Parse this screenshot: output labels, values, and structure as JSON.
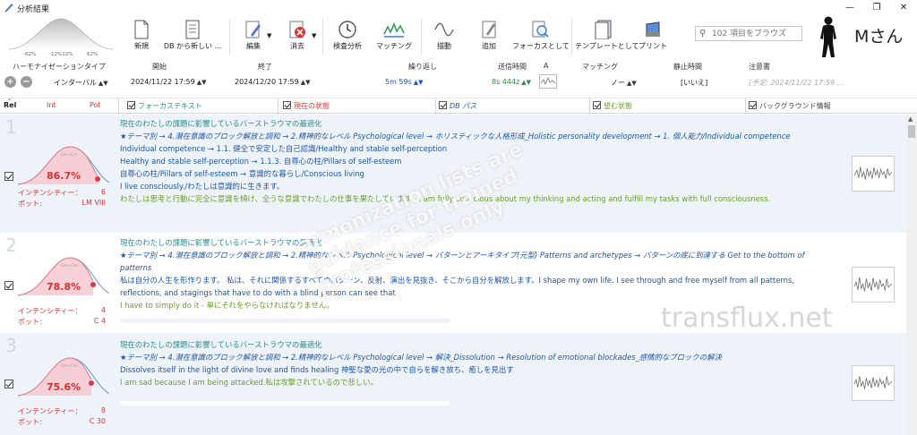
{
  "titlebar": {
    "title": "分析結果"
  },
  "ribbon": {
    "axis_ticks": [
      "-62%",
      "-12%12%",
      "62%"
    ],
    "buttons": [
      {
        "label": "新規",
        "icon": "new-file-icon"
      },
      {
        "label": "DB から新しい ...",
        "icon": "db-list-icon"
      },
      {
        "label": "編集",
        "icon": "edit-pen-icon"
      },
      {
        "label": "消去",
        "icon": "erase-icon"
      },
      {
        "label": "検査分析",
        "icon": "inspect-clock-icon"
      },
      {
        "label": "マッチング",
        "icon": "matching-wave-icon"
      },
      {
        "label": "描動",
        "icon": "wave-icon"
      },
      {
        "label": "追加",
        "icon": "add-pen-icon"
      },
      {
        "label": "フォーカスとして",
        "icon": "focus-search-icon"
      },
      {
        "label": "テンプレートとして",
        "icon": "template-icon"
      },
      {
        "label": "プリント",
        "icon": "print-icon"
      }
    ],
    "search_placeholder": "102 項目をブラウズ",
    "user_name": "Mさん"
  },
  "header": {
    "labels": {
      "type": "ハーモナイゼーションタイプ",
      "start": "開始",
      "end": "終了",
      "repeat": "繰り返し",
      "send_time": "送信時間",
      "a": "A",
      "matching": "マッチング",
      "rest": "静止時間",
      "notice": "注意書"
    },
    "values": {
      "type": "インターバル",
      "start": "2024/11/22 17:59",
      "end": "2024/12/20 17:59",
      "repeat": "5m 59s",
      "send_time": "8s 444z",
      "matching": "ノー",
      "rest": "[いいえ]",
      "notice": "[予定: 2024/11/22 17:59 ..."
    }
  },
  "filters": {
    "rel": "Rel",
    "int": "Int",
    "pot": "Pot",
    "focus_text": "フォーカステキスト",
    "current_state": "現在の状態",
    "db_path": "DB パス",
    "desired_state": "望む状態",
    "background_info": "バックグラウンド情報"
  },
  "common": {
    "intensity_label": "インテンシティー：",
    "potency_label": "ポット:"
  },
  "rows": [
    {
      "num": "1",
      "percent": "86.7%",
      "intensity": "6",
      "potency": "LM VIII",
      "lines": [
        {
          "text": "現在のわたしの課題に影響しているバーストラウマの最適化",
          "style": "teal"
        },
        {
          "text": "★テーマ別 → 4.潜在意識のブロック解放と調和 → 2.精神的なレベル Psychological level → ホリスティックな人格形成_Holistic personality development → 1. 個人能力/Individual competence",
          "style": "blueit"
        },
        {
          "text": "Individual competence → 1.1. 健全で安定した自己認識/Healthy and stable self-perception",
          "style": "blue"
        },
        {
          "text": "Healthy and stable self-perception → 1.1.3. 自尊心の柱/Pillars of self-esteem",
          "style": "blue"
        },
        {
          "text": "自尊心の柱/Pillars of self-esteem → 意識的な暮らし/Conscious living",
          "style": "blue"
        },
        {
          "text": "I live consciously./わたしは意識的に生きます。",
          "style": "blue"
        },
        {
          "text": "わたしは思考と行動に完全に意識を傾け、全うな意識でわたしの仕事を果たしています。I am fully conscious about my thinking and acting and fulfill my tasks with full consciousness.",
          "style": "green"
        }
      ]
    },
    {
      "num": "2",
      "percent": "78.8%",
      "intensity": "4",
      "potency": "C 4",
      "lines": [
        {
          "text": "現在のわたしの課題に影響しているバーストラウマの最適化",
          "style": "teal"
        },
        {
          "text": "★テーマ別 → 4.潜在意識のブロック解放と調和 → 2.精神的なレベル Psychological level → パターンとアーキタイプ(元型) Patterns and archetypes → パターンの底に到達する Get to the bottom of",
          "style": "blueit"
        },
        {
          "text": "patterns",
          "style": "blueit"
        },
        {
          "text": "私は自分の人生を形作ります。 私は、それに関係するすべてのパターン、反射、演出を見抜き、そこから自分を解放します。I shape my own life. I see through and free myself from all patterns,",
          "style": "blue"
        },
        {
          "text": "reflections, and stagings that have to do with a blind person can see that",
          "style": "blue"
        },
        {
          "text": "I have to simply do it - 単にそれをやらなければなりません。",
          "style": "green"
        }
      ]
    },
    {
      "num": "3",
      "percent": "75.6%",
      "intensity": "8",
      "potency": "C 30",
      "lines": [
        {
          "text": "現在のわたしの課題に影響しているバーストラウマの最適化",
          "style": "teal"
        },
        {
          "text": "★テーマ別 → 4.潜在意識のブロック解放と調和 → 2.精神的なレベル Psychological level → 解決_Dissolution → Resolution of emotional blockades_感情的なブロックの解決",
          "style": "blueit"
        },
        {
          "text": "Dissolves itself in the light of divine love and finds healing 神聖な愛の光の中で自らを解き放ち、癒しを見出す",
          "style": "blue"
        },
        {
          "text": "I am sad because I am being attacked.私は攻撃されているので悲しい。",
          "style": "green"
        }
      ]
    }
  ],
  "watermark": {
    "diagonal": "armonization lists are\nguidance for trained\nprofessionals only",
    "site": "transflux.net"
  },
  "colors": {
    "teal": "#2a8c8c",
    "blue": "#1f56a7",
    "green": "#6a9e2a",
    "red": "#d63030"
  }
}
